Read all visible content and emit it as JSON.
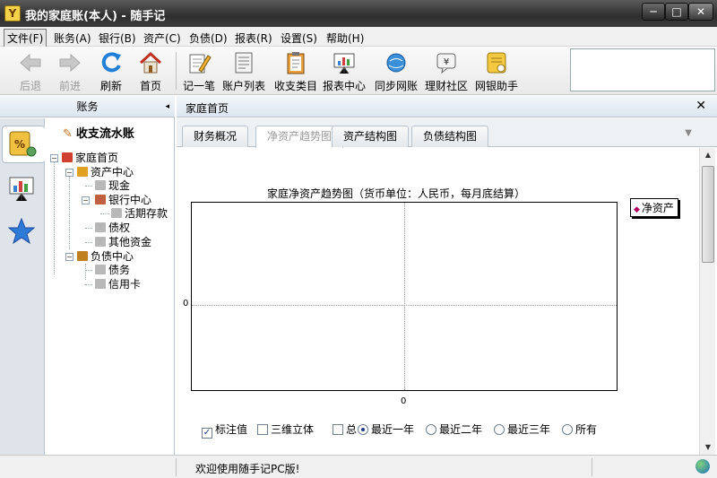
{
  "window": {
    "title": "我的家庭账(本人) - 随手记",
    "app_icon_letter": "Y",
    "controls": {
      "minimize": "─",
      "maximize": "□",
      "close": "✕"
    }
  },
  "menu": [
    "文件(F)",
    "账务(A)",
    "银行(B)",
    "资产(C)",
    "负债(D)",
    "报表(R)",
    "设置(S)",
    "帮助(H)"
  ],
  "toolbar": {
    "back": "后退",
    "forward": "前进",
    "refresh": "刷新",
    "home": "首页",
    "record": "记一笔",
    "accounts": "账户列表",
    "categories": "收支类目",
    "reports": "报表中心",
    "sync": "同步网账",
    "community": "理财社区",
    "bank_helper": "网银助手"
  },
  "sidebar": {
    "header": "账务",
    "collapse": "◂",
    "title": "收支流水账",
    "tree": {
      "root": "家庭首页",
      "assets": "资产中心",
      "cash": "现金",
      "bank": "银行中心",
      "deposit": "活期存款",
      "debt_claim": "债权",
      "other_funds": "其他资金",
      "liabilities": "负债中心",
      "debt": "债务",
      "credit_card": "信用卡"
    }
  },
  "main": {
    "title": "家庭首页",
    "close": "✕",
    "tabs": [
      "财务概况",
      "净资产趋势图",
      "资产结构图",
      "负债结构图"
    ],
    "tab_menu": "▼"
  },
  "chart_data": {
    "type": "line",
    "title": "家庭净资产趋势图（货币单位：人民币，每月底结算）",
    "series": [
      {
        "name": "净资产",
        "values": []
      }
    ],
    "x_tick_labels": [
      "0"
    ],
    "y_tick_labels": [
      "0"
    ],
    "grid": true,
    "legend_position": "top-right"
  },
  "options": {
    "show_values": {
      "label": "标注值",
      "checked": true
    },
    "three_d": {
      "label": "三维立体",
      "checked": false
    },
    "total": {
      "label": "总",
      "checked": false
    },
    "ranges": [
      "最近一年",
      "最近二年",
      "最近三年",
      "所有"
    ],
    "selected_range": "最近一年"
  },
  "status": {
    "message": "欢迎使用随手记PC版!"
  },
  "colors": {
    "accent": "#2e6db4",
    "legend_marker": "#b00060"
  }
}
